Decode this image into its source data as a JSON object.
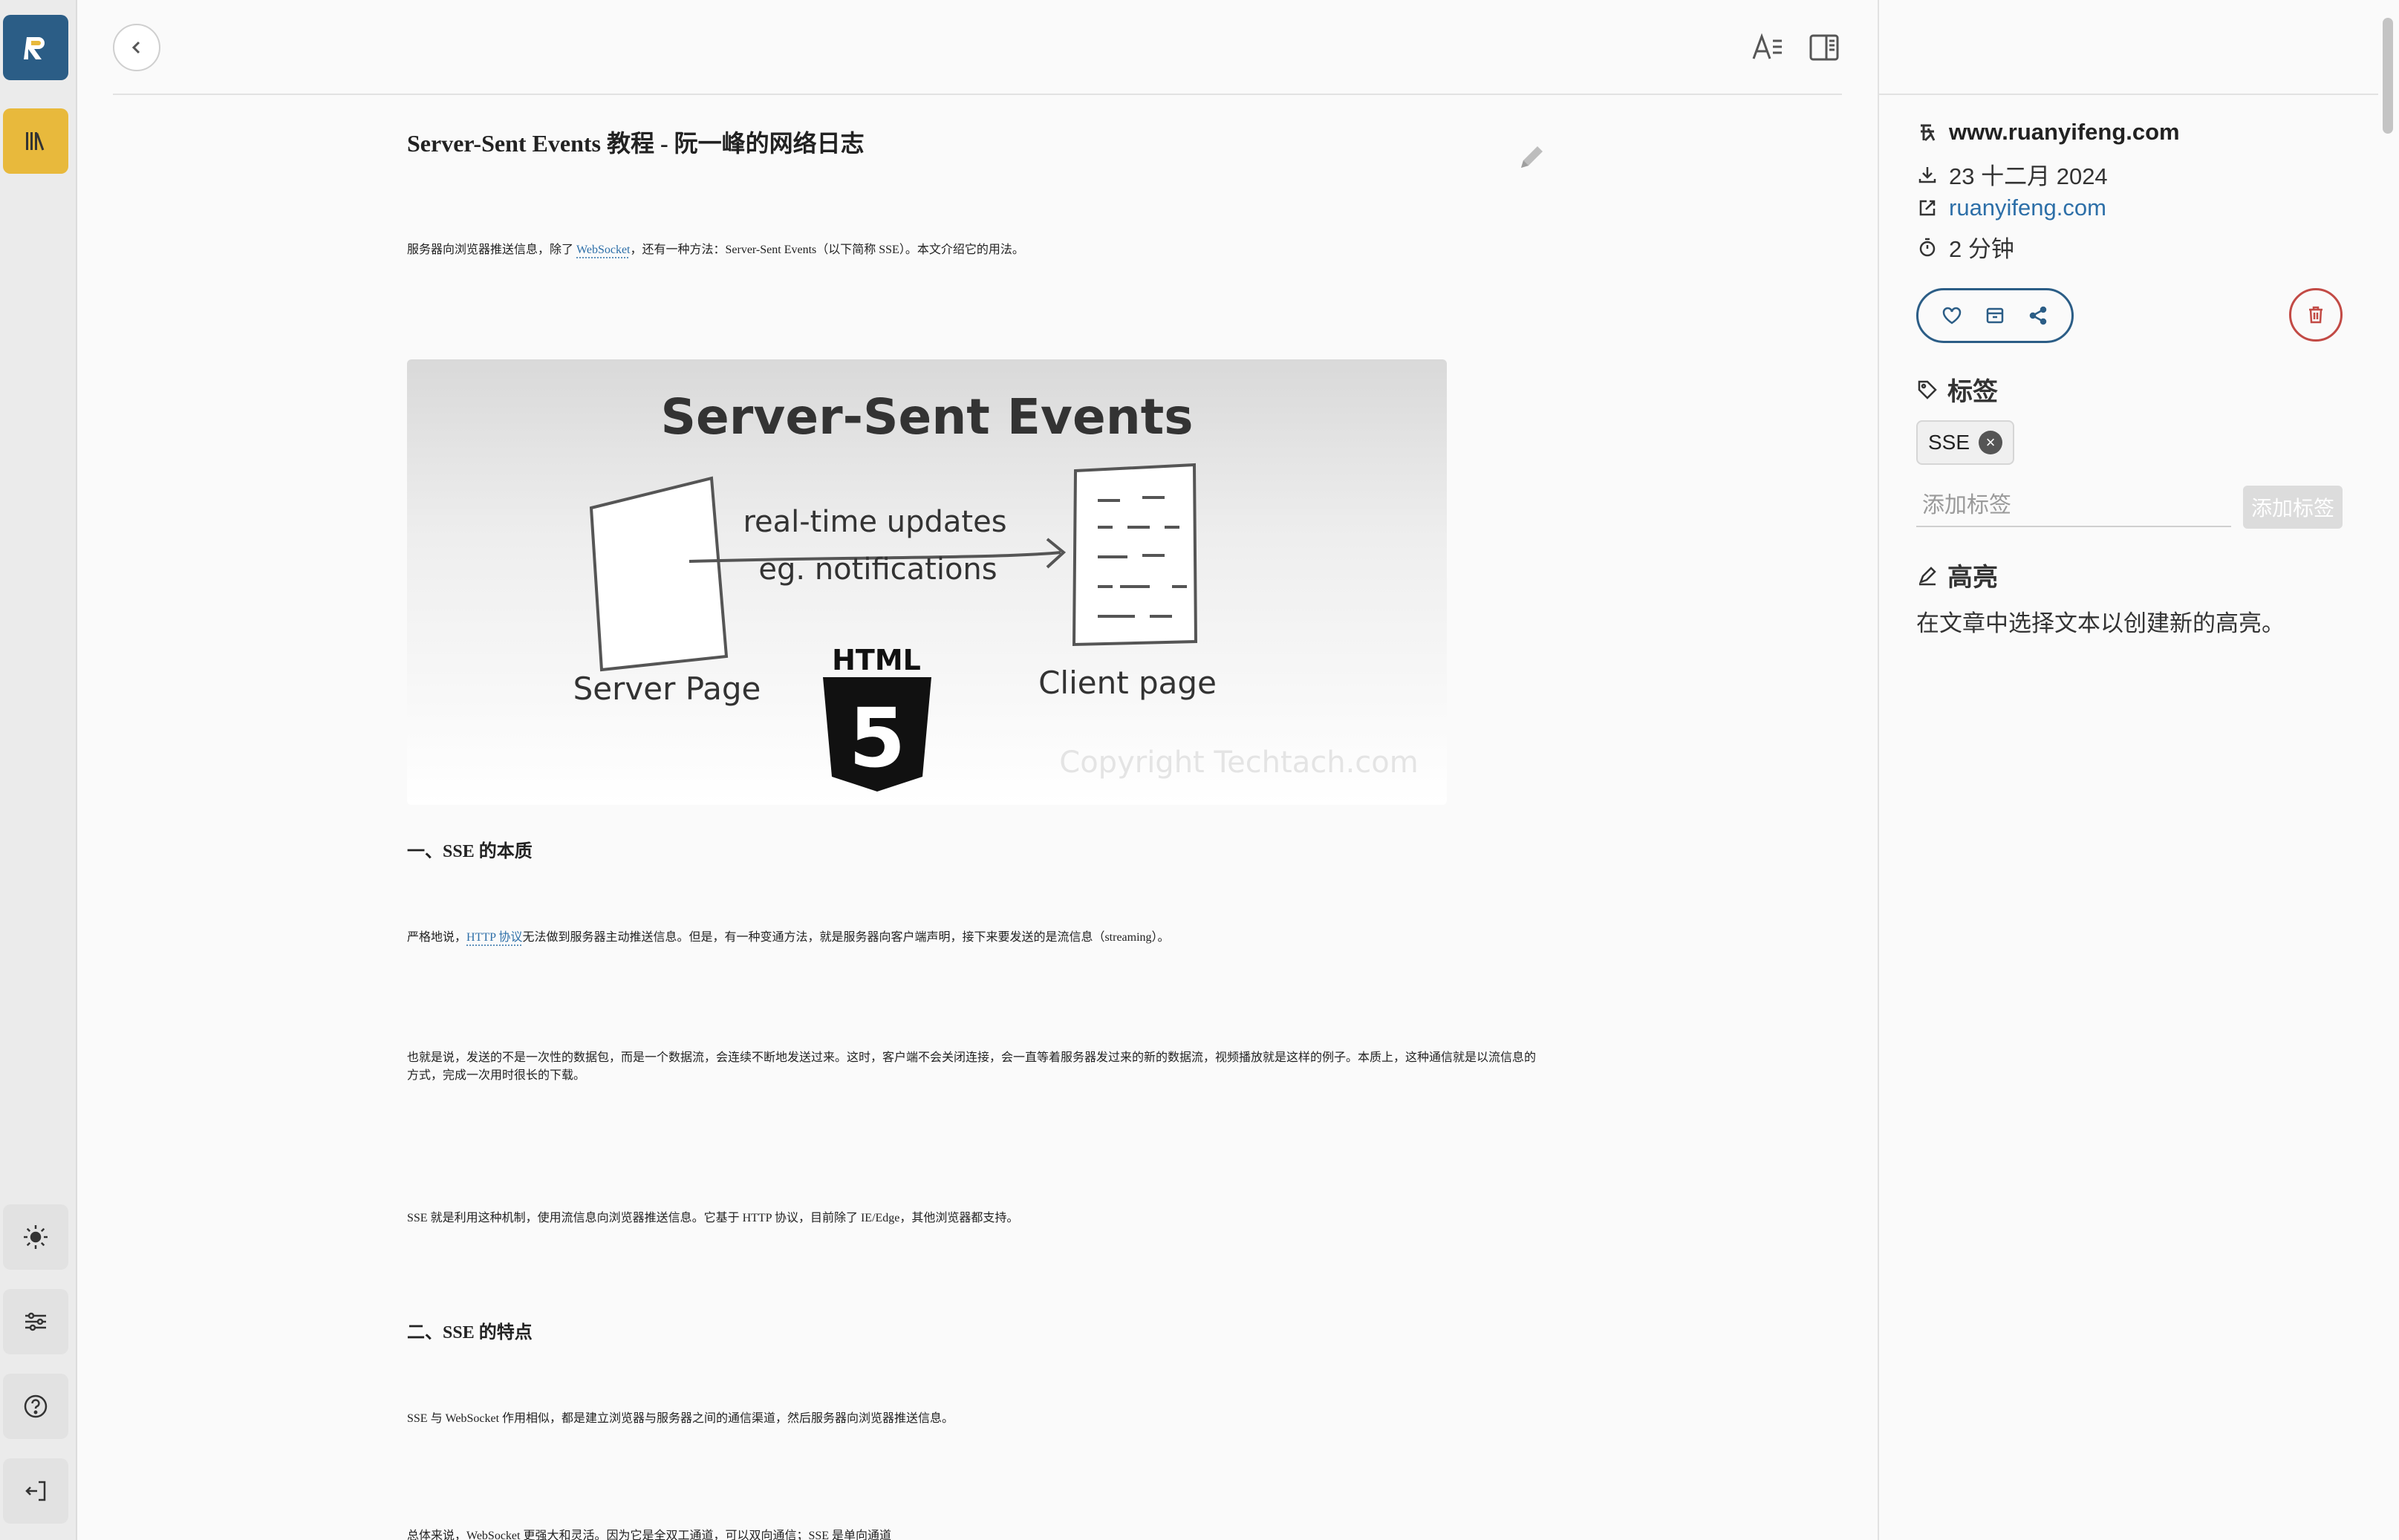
{
  "app": {
    "logo_icon": "reader-app-logo-icon",
    "library_icon": "library-books-icon"
  },
  "rail_bottom": [
    {
      "name": "theme-toggle-button",
      "icon": "sun-icon"
    },
    {
      "name": "preferences-button",
      "icon": "sliders-icon"
    },
    {
      "name": "help-button",
      "icon": "help-circle-icon"
    },
    {
      "name": "logout-button",
      "icon": "logout-icon"
    }
  ],
  "toolbar": {
    "back_icon": "chevron-left-icon",
    "font_settings_icon": "font-settings-icon",
    "toggle_panel_icon": "sidebar-toggle-icon"
  },
  "article": {
    "title": "Server-Sent Events 教程 - 阮一峰的网络日志",
    "intro_before_link": "服务器向浏览器推送信息，除了 ",
    "intro_link": "WebSocket",
    "intro_after_link": "，还有一种方法：Server-Sent Events（以下简称 SSE）。本文介绍它的用法。",
    "hero": {
      "title": "Server-Sent Events",
      "arrow_label_1": "real-time updates",
      "arrow_label_2": "eg. notifications",
      "server_label": "Server Page",
      "client_label": "Client page",
      "html_label": "HTML",
      "html_number": "5",
      "watermark": "Copyright Techtach.com"
    },
    "h2_1": "一、SSE 的本质",
    "p1_before_link": "严格地说，",
    "p1_link": "HTTP 协议",
    "p1_after_link": "无法做到服务器主动推送信息。但是，有一种变通方法，就是服务器向客户端声明，接下来要发送的是流信息（streaming）。",
    "p2": "也就是说，发送的不是一次性的数据包，而是一个数据流，会连续不断地发送过来。这时，客户端不会关闭连接，会一直等着服务器发过来的新的数据流，视频播放就是这样的例子。本质上，这种通信就是以流信息的方式，完成一次用时很长的下载。",
    "p3": "SSE 就是利用这种机制，使用流信息向浏览器推送信息。它基于 HTTP 协议，目前除了 IE/Edge，其他浏览器都支持。",
    "h2_2": "二、SSE 的特点",
    "p4": "SSE 与 WebSocket 作用相似，都是建立浏览器与服务器之间的通信渠道，然后服务器向浏览器推送信息。",
    "p5": "总体来说，WebSocket 更强大和灵活。因为它是全双工通道，可以双向通信；SSE 是单向通道"
  },
  "panel": {
    "site": "www.ruanyifeng.com",
    "saved_date": "23 十二月 2024",
    "source_link": "ruanyifeng.com",
    "read_time": "2 分钟",
    "tags_heading": "标签",
    "tags": [
      "SSE"
    ],
    "tag_input_placeholder": "添加标签",
    "add_tag_label": "添加标签",
    "highlights_heading": "高亮",
    "highlights_hint": "在文章中选择文本以创建新的高亮。"
  }
}
